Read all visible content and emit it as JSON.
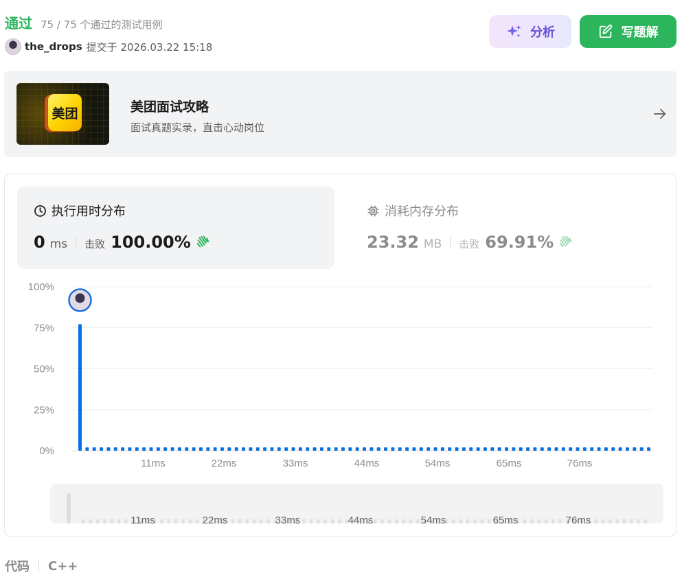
{
  "header": {
    "status": "通过",
    "cases": "75 / 75 个通过的测试用例",
    "username": "the_drops",
    "submitted": "提交于 2026.03.22 15:18",
    "analyze_label": "分析",
    "solution_label": "写题解"
  },
  "banner": {
    "logo_text": "美团",
    "title": "美团面试攻略",
    "subtitle": "面试真题实录，直击心动岗位"
  },
  "runtime": {
    "title": "执行用时分布",
    "value": "0",
    "unit": "ms",
    "beat_label": "击败",
    "beat_pct": "100.00%"
  },
  "memory": {
    "title": "消耗内存分布",
    "value": "23.32",
    "unit": "MB",
    "beat_label": "击败",
    "beat_pct": "69.91%"
  },
  "footer": {
    "code_label": "代码",
    "language": "C++"
  },
  "colors": {
    "accent_green": "#2db55d",
    "bar_blue": "#0a6fe6",
    "analyze_purple": "#6b4fd8"
  },
  "chart_data": {
    "type": "bar",
    "title": "",
    "xlabel": "",
    "ylabel": "",
    "yticks": [
      "0%",
      "25%",
      "50%",
      "75%",
      "100%"
    ],
    "ylim": [
      0,
      100
    ],
    "xticks": [
      "11ms",
      "22ms",
      "33ms",
      "44ms",
      "54ms",
      "65ms",
      "76ms"
    ],
    "grid": true,
    "highlight_index": 0,
    "values": [
      77.2,
      0.8,
      0.8,
      1.2,
      0.8,
      0.8,
      0.8,
      0.8,
      0.8,
      0.8,
      0.8,
      0.8,
      0.8,
      0.8,
      0.8,
      0.8,
      0.8,
      0.8,
      0.8,
      0.8,
      0.8,
      0.8,
      0.8,
      0.8,
      0.8,
      0.8,
      0.8,
      0.8,
      0.8,
      0.8,
      0.8,
      0.8,
      0.8,
      0.8,
      0.8,
      0.8,
      0.8,
      0.8,
      0.8,
      0.8,
      0.8,
      0.8,
      0.8,
      0.8,
      0.8,
      0.8,
      0.8,
      0.8,
      0.8,
      0.8,
      0.8,
      0.8,
      0.8,
      0.8,
      0.8,
      0.8,
      0.8,
      0.8,
      0.8,
      0.8,
      0.8,
      0.8,
      0.8,
      0.8,
      0.8,
      0.8,
      0.8,
      0.8,
      0.8,
      0.8,
      0.8,
      0.8,
      0.8,
      0.8,
      0.8,
      0.8,
      0.8,
      0.8,
      0.8,
      0.8,
      0.8
    ],
    "navigator_xticks": [
      "11ms",
      "22ms",
      "33ms",
      "44ms",
      "54ms",
      "65ms",
      "76ms"
    ]
  }
}
